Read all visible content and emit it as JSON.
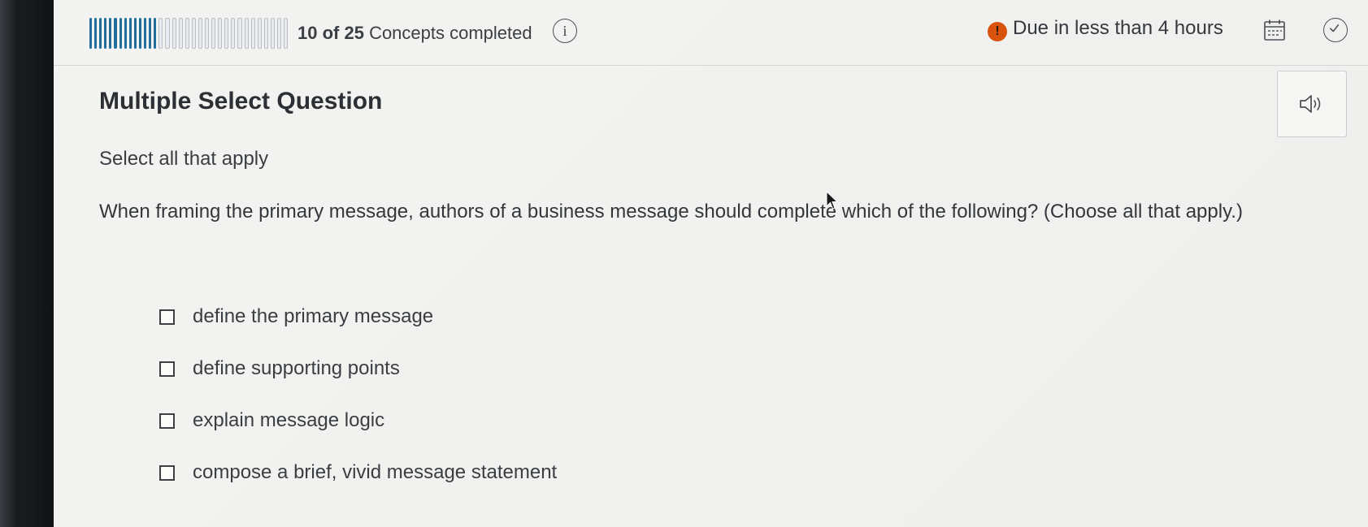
{
  "header": {
    "progress": {
      "completed": 10,
      "total": 25,
      "segments": 34,
      "filled_segments": 14
    },
    "concepts_count": "10 of 25",
    "concepts_suffix": "Concepts completed",
    "info_icon": "info-icon",
    "info_glyph": "i",
    "due_icon": "alert-icon",
    "due_glyph": "!",
    "due_text": "Due in less than 4 hours",
    "calendar_icon": "calendar-icon",
    "check_icon": "check-circle-icon"
  },
  "question": {
    "type_title": "Multiple Select Question",
    "instruction": "Select all that apply",
    "prompt": "When framing the primary message, authors of a business message should complete which of the following? (Choose all that apply.)",
    "options": [
      {
        "label": "define the primary message",
        "checked": false
      },
      {
        "label": "define supporting points",
        "checked": false
      },
      {
        "label": "explain message logic",
        "checked": false
      },
      {
        "label": "compose a brief, vivid message statement",
        "checked": false
      }
    ]
  },
  "audio_button": {
    "icon": "speaker-icon"
  },
  "colors": {
    "progress_filled": "#1f6e9c",
    "progress_empty": "#e9ecef",
    "due_alert": "#d9530e",
    "text": "#33373c"
  }
}
